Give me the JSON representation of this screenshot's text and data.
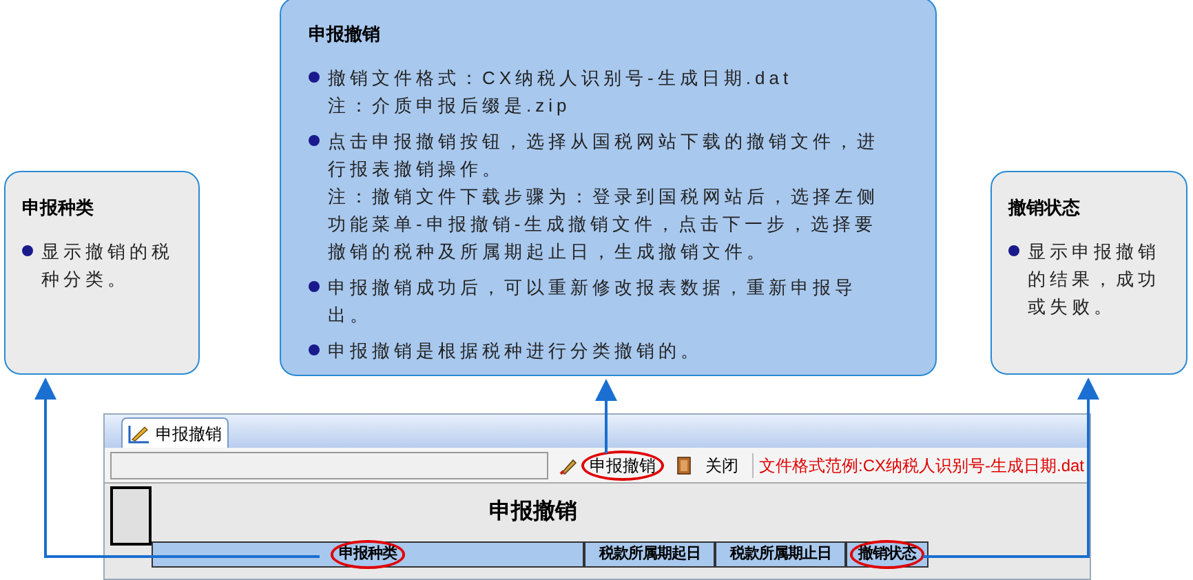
{
  "callouts": [
    {
      "title": "申报种类",
      "items": [
        {
          "lines": [
            "显示撤销的税种分类。"
          ]
        }
      ]
    },
    {
      "title": "申报撤销",
      "items": [
        {
          "lines": [
            "撤销文件格式：CX纳税人识别号-生成日期.dat",
            "注：介质申报后缀是.zip"
          ]
        },
        {
          "lines": [
            "点击申报撤销按钮，选择从国税网站下载的撤销文件，进行报表撤销操作。",
            "注：撤销文件下载步骤为：登录到国税网站后，选择左侧功能菜单-申报撤销-生成撤销文件，点击下一步，选择要撤销的税种及所属期起止日，生成撤销文件。"
          ]
        },
        {
          "lines": [
            "申报撤销成功后，可以重新修改报表数据，重新申报导出。"
          ]
        },
        {
          "lines": [
            "申报撤销是根据税种进行分类撤销的。"
          ]
        }
      ]
    },
    {
      "title": "撤销状态",
      "items": [
        {
          "lines": [
            "显示申报撤销的结果，成功或失败。"
          ]
        }
      ]
    }
  ],
  "window": {
    "tabs": [
      {
        "label": "申报撤销",
        "selected": true
      }
    ],
    "toolbar": {
      "buttons": [
        {
          "label": "申报撤销",
          "kind": "revoke",
          "highlighted": true
        },
        {
          "label": "关闭",
          "kind": "close",
          "highlighted": false
        }
      ],
      "hint": "文件格式范例:CX纳税人识别号-生成日期.dat"
    },
    "report": {
      "title": "申报撤销",
      "columns": [
        {
          "label": "申报种类",
          "highlighted": true
        },
        {
          "label": "税款所属期起日",
          "highlighted": false
        },
        {
          "label": "税款所属期止日",
          "highlighted": false
        },
        {
          "label": "撤销状态",
          "highlighted": true
        }
      ]
    }
  }
}
